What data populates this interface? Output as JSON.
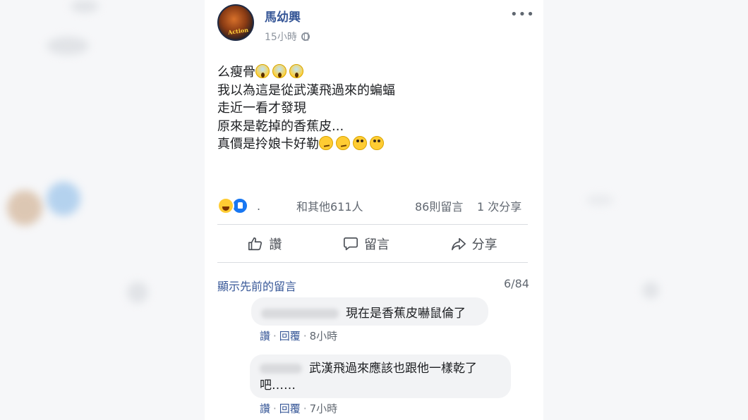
{
  "post": {
    "author": "馬幼興",
    "time": "15小時",
    "privacy_icon": "globe-icon",
    "lines": [
      "么瘦骨",
      "我以為這是從武漢飛過來的蝙蝠",
      "走近一看才發現",
      "原來是乾掉的香蕉皮...",
      "真價是拎娘卡好勒"
    ],
    "avatar_text": "Action"
  },
  "reactions": {
    "summary": "和其他611人",
    "dot": ".",
    "comments": "86則留言",
    "shares": "1 次分享"
  },
  "actions": {
    "like": "讚",
    "comment": "留言",
    "share": "分享"
  },
  "comments_section": {
    "show_previous": "顯示先前的留言",
    "count": "6/84",
    "items": [
      {
        "text": "現在是香蕉皮嚇鼠倫了",
        "like": "讚",
        "reply": "回覆",
        "time": "8小時"
      },
      {
        "text_line1": "武漢飛過來應該也跟他一樣乾了",
        "text_line2": "吧……",
        "like": "讚",
        "reply": "回覆",
        "time": "7小時"
      }
    ]
  },
  "colors": {
    "link": "#385898",
    "like_blue": "#1877f2",
    "muted": "#606770"
  }
}
